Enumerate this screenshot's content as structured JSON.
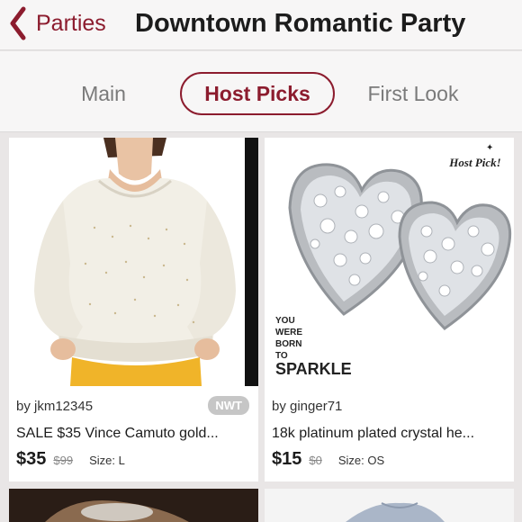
{
  "header": {
    "back_label": "Parties",
    "title": "Downtown Romantic Party"
  },
  "tabs": [
    {
      "label": "Main",
      "active": false
    },
    {
      "label": "Host Picks",
      "active": true
    },
    {
      "label": "First Look",
      "active": false
    }
  ],
  "listings": [
    {
      "seller": "by jkm12345",
      "badge": "NWT",
      "title": "SALE $35 Vince Camuto gold...",
      "price": "$35",
      "original_price": "$99",
      "size": "Size: L"
    },
    {
      "seller": "by ginger71",
      "title": "18k platinum plated crystal he...",
      "price": "$15",
      "original_price": "$0",
      "size": "Size: OS",
      "overlay": {
        "host_pick": "Host Pick!",
        "tagline": [
          "YOU",
          "WERE",
          "BORN",
          "TO",
          "SPARKLE"
        ]
      }
    }
  ],
  "colors": {
    "accent": "#8c1c2e",
    "badge": "#c6c6c6",
    "background": "#e9e6e6"
  }
}
